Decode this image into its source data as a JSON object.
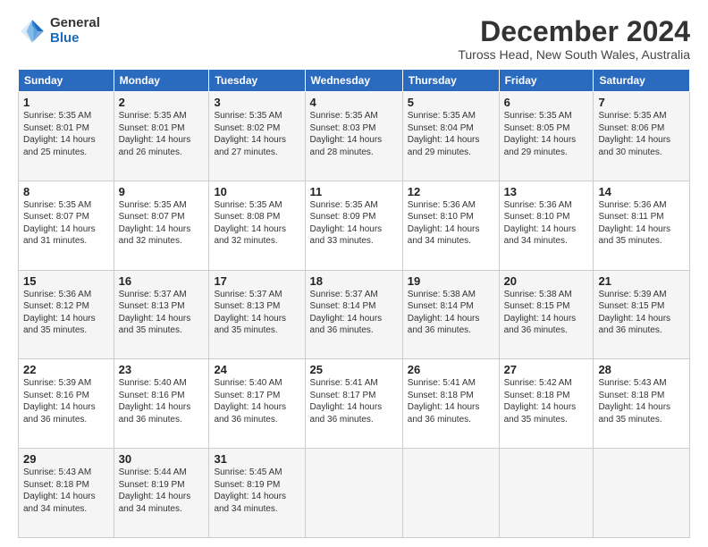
{
  "logo": {
    "general": "General",
    "blue": "Blue"
  },
  "title": "December 2024",
  "subtitle": "Tuross Head, New South Wales, Australia",
  "weekdays": [
    "Sunday",
    "Monday",
    "Tuesday",
    "Wednesday",
    "Thursday",
    "Friday",
    "Saturday"
  ],
  "weeks": [
    [
      {
        "day": "1",
        "info": "Sunrise: 5:35 AM\nSunset: 8:01 PM\nDaylight: 14 hours\nand 25 minutes."
      },
      {
        "day": "2",
        "info": "Sunrise: 5:35 AM\nSunset: 8:01 PM\nDaylight: 14 hours\nand 26 minutes."
      },
      {
        "day": "3",
        "info": "Sunrise: 5:35 AM\nSunset: 8:02 PM\nDaylight: 14 hours\nand 27 minutes."
      },
      {
        "day": "4",
        "info": "Sunrise: 5:35 AM\nSunset: 8:03 PM\nDaylight: 14 hours\nand 28 minutes."
      },
      {
        "day": "5",
        "info": "Sunrise: 5:35 AM\nSunset: 8:04 PM\nDaylight: 14 hours\nand 29 minutes."
      },
      {
        "day": "6",
        "info": "Sunrise: 5:35 AM\nSunset: 8:05 PM\nDaylight: 14 hours\nand 29 minutes."
      },
      {
        "day": "7",
        "info": "Sunrise: 5:35 AM\nSunset: 8:06 PM\nDaylight: 14 hours\nand 30 minutes."
      }
    ],
    [
      {
        "day": "8",
        "info": "Sunrise: 5:35 AM\nSunset: 8:07 PM\nDaylight: 14 hours\nand 31 minutes."
      },
      {
        "day": "9",
        "info": "Sunrise: 5:35 AM\nSunset: 8:07 PM\nDaylight: 14 hours\nand 32 minutes."
      },
      {
        "day": "10",
        "info": "Sunrise: 5:35 AM\nSunset: 8:08 PM\nDaylight: 14 hours\nand 32 minutes."
      },
      {
        "day": "11",
        "info": "Sunrise: 5:35 AM\nSunset: 8:09 PM\nDaylight: 14 hours\nand 33 minutes."
      },
      {
        "day": "12",
        "info": "Sunrise: 5:36 AM\nSunset: 8:10 PM\nDaylight: 14 hours\nand 34 minutes."
      },
      {
        "day": "13",
        "info": "Sunrise: 5:36 AM\nSunset: 8:10 PM\nDaylight: 14 hours\nand 34 minutes."
      },
      {
        "day": "14",
        "info": "Sunrise: 5:36 AM\nSunset: 8:11 PM\nDaylight: 14 hours\nand 35 minutes."
      }
    ],
    [
      {
        "day": "15",
        "info": "Sunrise: 5:36 AM\nSunset: 8:12 PM\nDaylight: 14 hours\nand 35 minutes."
      },
      {
        "day": "16",
        "info": "Sunrise: 5:37 AM\nSunset: 8:13 PM\nDaylight: 14 hours\nand 35 minutes."
      },
      {
        "day": "17",
        "info": "Sunrise: 5:37 AM\nSunset: 8:13 PM\nDaylight: 14 hours\nand 35 minutes."
      },
      {
        "day": "18",
        "info": "Sunrise: 5:37 AM\nSunset: 8:14 PM\nDaylight: 14 hours\nand 36 minutes."
      },
      {
        "day": "19",
        "info": "Sunrise: 5:38 AM\nSunset: 8:14 PM\nDaylight: 14 hours\nand 36 minutes."
      },
      {
        "day": "20",
        "info": "Sunrise: 5:38 AM\nSunset: 8:15 PM\nDaylight: 14 hours\nand 36 minutes."
      },
      {
        "day": "21",
        "info": "Sunrise: 5:39 AM\nSunset: 8:15 PM\nDaylight: 14 hours\nand 36 minutes."
      }
    ],
    [
      {
        "day": "22",
        "info": "Sunrise: 5:39 AM\nSunset: 8:16 PM\nDaylight: 14 hours\nand 36 minutes."
      },
      {
        "day": "23",
        "info": "Sunrise: 5:40 AM\nSunset: 8:16 PM\nDaylight: 14 hours\nand 36 minutes."
      },
      {
        "day": "24",
        "info": "Sunrise: 5:40 AM\nSunset: 8:17 PM\nDaylight: 14 hours\nand 36 minutes."
      },
      {
        "day": "25",
        "info": "Sunrise: 5:41 AM\nSunset: 8:17 PM\nDaylight: 14 hours\nand 36 minutes."
      },
      {
        "day": "26",
        "info": "Sunrise: 5:41 AM\nSunset: 8:18 PM\nDaylight: 14 hours\nand 36 minutes."
      },
      {
        "day": "27",
        "info": "Sunrise: 5:42 AM\nSunset: 8:18 PM\nDaylight: 14 hours\nand 35 minutes."
      },
      {
        "day": "28",
        "info": "Sunrise: 5:43 AM\nSunset: 8:18 PM\nDaylight: 14 hours\nand 35 minutes."
      }
    ],
    [
      {
        "day": "29",
        "info": "Sunrise: 5:43 AM\nSunset: 8:18 PM\nDaylight: 14 hours\nand 34 minutes."
      },
      {
        "day": "30",
        "info": "Sunrise: 5:44 AM\nSunset: 8:19 PM\nDaylight: 14 hours\nand 34 minutes."
      },
      {
        "day": "31",
        "info": "Sunrise: 5:45 AM\nSunset: 8:19 PM\nDaylight: 14 hours\nand 34 minutes."
      },
      null,
      null,
      null,
      null
    ]
  ]
}
